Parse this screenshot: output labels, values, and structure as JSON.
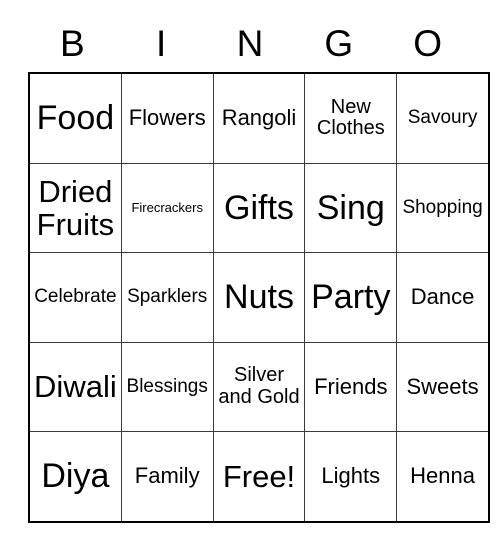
{
  "card": {
    "title": "BINGO",
    "header_letters": [
      "B",
      "I",
      "N",
      "G",
      "O"
    ],
    "rows": [
      [
        {
          "label": "Food",
          "size": "xl"
        },
        {
          "label": "Flowers",
          "size": "md"
        },
        {
          "label": "Rangoli",
          "size": "md"
        },
        {
          "label": "New Clothes",
          "size": "two"
        },
        {
          "label": "Savoury",
          "size": "sm"
        }
      ],
      [
        {
          "label": "Dried Fruits",
          "size": "lg"
        },
        {
          "label": "Firecrackers",
          "size": "xs"
        },
        {
          "label": "Gifts",
          "size": "xl"
        },
        {
          "label": "Sing",
          "size": "xl"
        },
        {
          "label": "Shopping",
          "size": "sm"
        }
      ],
      [
        {
          "label": "Celebrate",
          "size": "sm"
        },
        {
          "label": "Sparklers",
          "size": "sm"
        },
        {
          "label": "Nuts",
          "size": "xl"
        },
        {
          "label": "Party",
          "size": "xl"
        },
        {
          "label": "Dance",
          "size": "md"
        }
      ],
      [
        {
          "label": "Diwali",
          "size": "lg"
        },
        {
          "label": "Blessings",
          "size": "sm"
        },
        {
          "label": "Silver and Gold",
          "size": "three"
        },
        {
          "label": "Friends",
          "size": "md"
        },
        {
          "label": "Sweets",
          "size": "md"
        }
      ],
      [
        {
          "label": "Diya",
          "size": "xl"
        },
        {
          "label": "Family",
          "size": "md"
        },
        {
          "label": "Free!",
          "size": "lg"
        },
        {
          "label": "Lights",
          "size": "md"
        },
        {
          "label": "Henna",
          "size": "md"
        }
      ]
    ],
    "colors": {
      "background": "#ffffff",
      "text": "#000000",
      "grid_line": "#3a3a3a",
      "outer_border": "#000000"
    }
  }
}
